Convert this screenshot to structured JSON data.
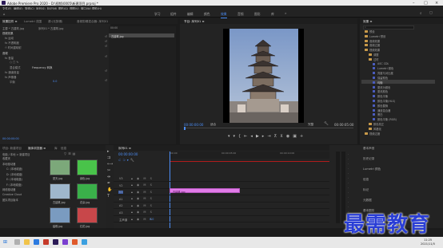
{
  "window": {
    "title": "Adobe Premiere Pro 2020 - D:\\视频\\0005\\新建项目.prproj *"
  },
  "menu": [
    "文件(F)",
    "编辑(E)",
    "剪辑(C)",
    "序列(S)",
    "标记(M)",
    "图形(G)",
    "视图(V)",
    "窗口(W)",
    "帮助(H)"
  ],
  "workspaces": [
    "学习",
    "组件",
    "编辑",
    "颜色",
    "效果",
    "音频",
    "图形",
    "库"
  ],
  "active_workspace": "效果",
  "effect_controls": {
    "tabs": [
      "效果控件 ≡",
      "Lumetri 范围",
      "源:(无剪辑)",
      "音频剪辑混合器: 序列01"
    ],
    "source_label": "主要 * 古建筑.jpg",
    "seq_label": "序列01 * 古建筑.jpg",
    "timecode_top": "00:00",
    "clip_name": "古建筑.jpg",
    "section_video": "视频效果",
    "rows": [
      "fx  运动",
      "fx  不透明度",
      "⏱ 时间重映射"
    ],
    "section_audio": "音频",
    "audio_rows": [
      "fx  音量",
      "fx  通道音量",
      "fx  声像器"
    ],
    "mask_row": "○ □ ✎",
    "mode_label": "混合模式",
    "mode_value": "Frequency 转换",
    "balance_label": "平衡",
    "balance_value": "0.0",
    "timecode": "00:00:00:00"
  },
  "program_monitor": {
    "tab": "节目: 序列01 ≡",
    "timecode_left": "00:00:00:00",
    "fit": "适合",
    "quality": "完整",
    "timecode_right": "00:00:05:00"
  },
  "effects": {
    "tab": "效果 ≡",
    "search_placeholder": "",
    "items": [
      {
        "label": "预设",
        "type": "folder"
      },
      {
        "label": "Lumetri 预设",
        "type": "folder"
      },
      {
        "label": "音频效果",
        "type": "folder"
      },
      {
        "label": "音频过渡",
        "type": "folder"
      },
      {
        "label": "视频效果",
        "type": "folder"
      },
      {
        "label": "调整",
        "type": "folder"
      },
      {
        "label": "过时",
        "type": "folder"
      },
      {
        "label": "ASC CDL",
        "type": "item"
      },
      {
        "label": "Lumetri 颜色",
        "type": "item"
      },
      {
        "label": "亮度与对比度",
        "type": "item"
      },
      {
        "label": "保留颜色",
        "type": "item"
      },
      {
        "label": "均衡",
        "type": "item"
      },
      {
        "label": "更改为颜色",
        "type": "item"
      },
      {
        "label": "更改颜色",
        "type": "item"
      },
      {
        "label": "颜色平衡",
        "type": "item"
      },
      {
        "label": "颜色平衡(HLS)",
        "type": "item"
      },
      {
        "label": "颜色替换",
        "type": "item"
      },
      {
        "label": "通道混合器",
        "type": "item"
      },
      {
        "label": "黑白",
        "type": "item"
      },
      {
        "label": "颜色平衡 (RGB)",
        "type": "item"
      },
      {
        "label": "颜色校正",
        "type": "folder"
      },
      {
        "label": "风格化",
        "type": "folder"
      },
      {
        "label": "视频过渡",
        "type": "folder"
      }
    ],
    "selected_index": 11
  },
  "project": {
    "tabs": [
      "项目: 新建项目",
      "媒体浏览器 ≡",
      "库",
      "信息"
    ],
    "path": "电脑 / 本地 > 新建项目",
    "tree": [
      "收藏夹",
      "本地驱动器",
      "C: (本地磁盘)",
      "D: (本地磁盘)",
      "E: (本地磁盘)",
      "F: (本地磁盘)",
      "网络驱动器",
      "Creative Cloud",
      "团队项目版本"
    ],
    "thumbs": [
      "夏天.jpg",
      "绿色.jpg",
      "古建筑.jpg",
      "花朵.jpg",
      "建筑.jpg",
      "红花.jpg"
    ]
  },
  "timeline": {
    "tab": "序列01 ≡",
    "timecode": "00:00:00:00",
    "tracks": [
      "V3",
      "V2",
      "V1",
      "A1",
      "A2",
      "A3",
      "主声道"
    ],
    "master_value": "0.0",
    "clip_label": "古建筑.jpg",
    "ruler": [
      "00:00",
      "00:00:05:00",
      "00:00:10:00"
    ]
  },
  "history": {
    "items": [
      "基本声音",
      "历史记录",
      "Lumetri 颜色",
      "信息",
      "标记",
      "元数据",
      "基本图形"
    ]
  },
  "taskbar": {
    "time": "11:25",
    "date": "2021/11/5"
  },
  "watermark": "最需教育",
  "colors": {
    "accent": "#4c8ef7",
    "clip": "#e17be8",
    "playhead": "#4c8ef7",
    "watermark": "#2a3ed6"
  }
}
